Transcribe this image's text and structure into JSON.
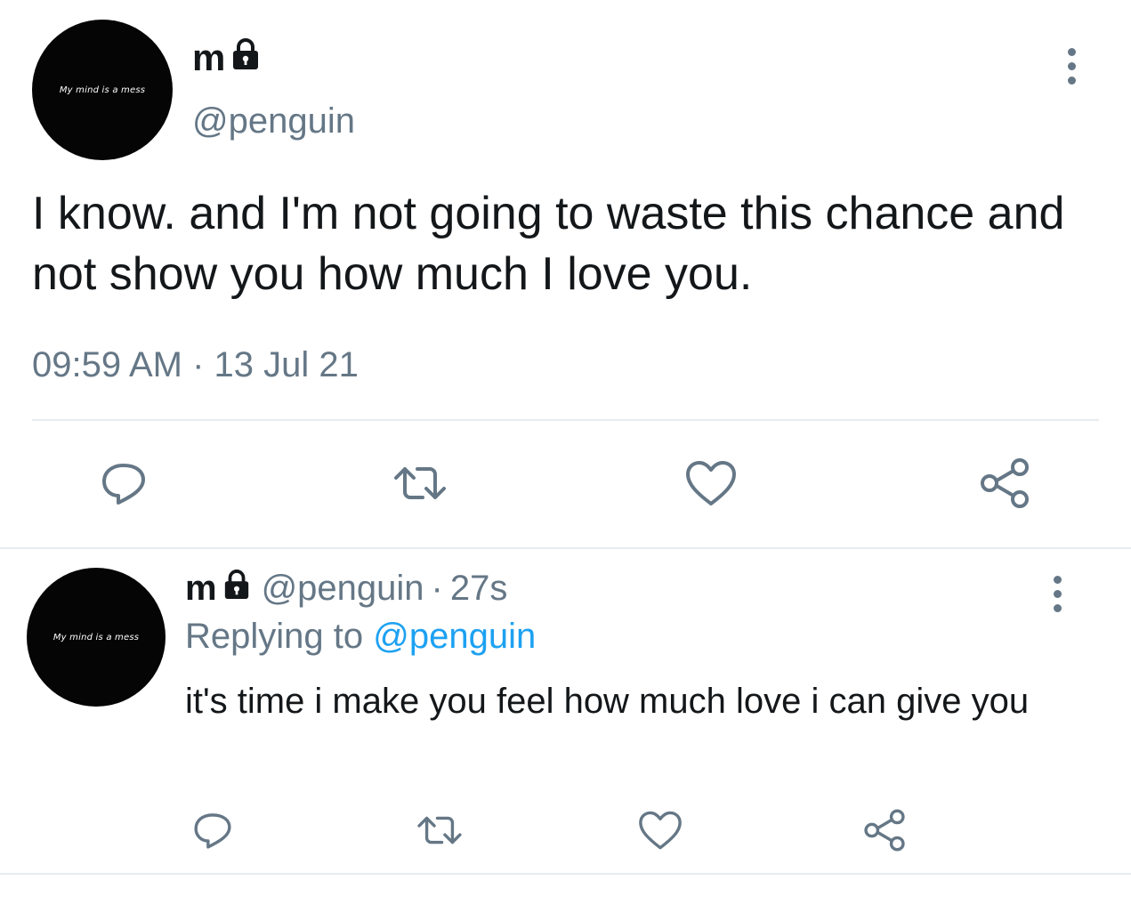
{
  "main_tweet": {
    "avatar_text": "My mind is a mess",
    "display_name": "m",
    "handle": "@penguin",
    "text": "I know. and I'm not going to waste this chance and not show you how much I love you.",
    "timestamp": "09:59 AM · 13 Jul 21"
  },
  "reply_tweet": {
    "avatar_text": "My mind is a mess",
    "display_name": "m",
    "handle": "@penguin",
    "separator": "·",
    "age": "27s",
    "replying_prefix": "Replying to",
    "replying_to": "@penguin",
    "text": "it's time i make you feel how much love i can give you"
  },
  "icons": {
    "lock": "lock-icon",
    "more": "more-vertical-icon",
    "reply": "reply-icon",
    "retweet": "retweet-icon",
    "like": "like-heart-icon",
    "share": "share-icon"
  },
  "colors": {
    "text_primary": "#14171a",
    "text_secondary": "#657786",
    "link": "#1da1f2",
    "divider": "#e6ecf0",
    "avatar_bg": "#050505"
  }
}
